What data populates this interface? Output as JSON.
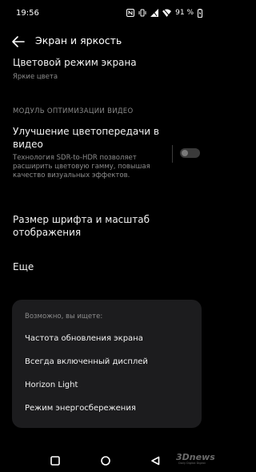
{
  "status_bar": {
    "time": "19:56",
    "battery_percent": "91 %",
    "icons": [
      "nfc-icon",
      "vibrate-icon",
      "signal-icon",
      "wifi-icon",
      "battery-icon"
    ]
  },
  "header": {
    "back_icon": "back-arrow-icon",
    "title": "Экран и яркость"
  },
  "settings": {
    "color_mode": {
      "title": "Цветовой режим экрана",
      "value": "Яркие цвета"
    },
    "video_section_header": "МОДУЛЬ ОПТИМИЗАЦИИ ВИДЕО",
    "video_enhance": {
      "title_line1": "Улучшение цветопередачи в",
      "title_line2": "видео",
      "desc_line1": "Технология SDR-to-HDR позволяет",
      "desc_line2": "расширить цветовую гамму, повышая",
      "desc_line3": "качество визуальных эффектов.",
      "enabled": false
    },
    "font_size": {
      "title": "Размер шрифта и масштаб отображения"
    },
    "more": {
      "title": "Еще"
    }
  },
  "suggestions": {
    "header": "Возможно, вы ищете:",
    "items": [
      {
        "label": "Частота обновления экрана"
      },
      {
        "label": "Всегда включенный дисплей"
      },
      {
        "label": "Horizon Light"
      },
      {
        "label": "Режим энергосбережения"
      }
    ]
  },
  "nav_bar": {
    "icons": [
      "recents-square-icon",
      "home-circle-icon",
      "back-triangle-icon"
    ]
  },
  "watermark": {
    "logo": "3Dnews",
    "tagline": "Daily Digital Digest"
  },
  "colors": {
    "background": "#000000",
    "card": "#1c1c1e",
    "secondary_text": "#8c8c8c",
    "primary_text": "#f2f2f2"
  }
}
